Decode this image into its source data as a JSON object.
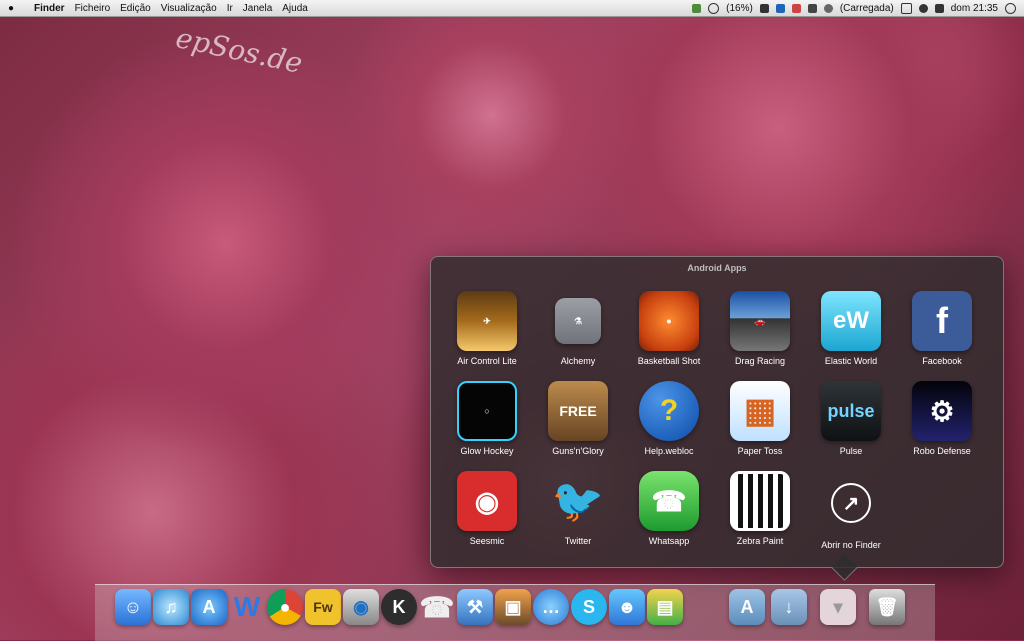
{
  "menubar": {
    "app_name": "Finder",
    "items": [
      "Ficheiro",
      "Edição",
      "Visualização",
      "Ir",
      "Janela",
      "Ajuda"
    ],
    "battery_percent": "(16%)",
    "battery_state": "(Carregada)",
    "clock": "dom 21:35"
  },
  "watermark": "epSos.de",
  "popover": {
    "title": "Android Apps",
    "apps": [
      {
        "label": "Air Control Lite",
        "icon": "airplane-icon"
      },
      {
        "label": "Alchemy",
        "icon": "flask-icon"
      },
      {
        "label": "Basketball Shot",
        "icon": "basketball-icon"
      },
      {
        "label": "Drag Racing",
        "icon": "race-car-icon"
      },
      {
        "label": "Elastic World",
        "icon": "elastic-world-icon"
      },
      {
        "label": "Facebook",
        "icon": "facebook-icon"
      },
      {
        "label": "Glow Hockey",
        "icon": "hockey-table-icon"
      },
      {
        "label": "Guns'n'Glory",
        "icon": "cowboy-icon"
      },
      {
        "label": "Help.webloc",
        "icon": "help-question-icon"
      },
      {
        "label": "Paper Toss",
        "icon": "trash-bin-icon"
      },
      {
        "label": "Pulse",
        "icon": "pulse-icon"
      },
      {
        "label": "Robo Defense",
        "icon": "robot-turret-icon"
      },
      {
        "label": "Seesmic",
        "icon": "raccoon-icon"
      },
      {
        "label": "Twitter",
        "icon": "bird-icon"
      },
      {
        "label": "Whatsapp",
        "icon": "phone-chat-icon"
      },
      {
        "label": "Zebra Paint",
        "icon": "zebra-icon"
      },
      {
        "label": "Abrir no Finder",
        "icon": "arrow-circle-icon"
      }
    ]
  },
  "dock": {
    "items": [
      {
        "name": "finder-icon"
      },
      {
        "name": "itunes-icon"
      },
      {
        "name": "app-store-icon"
      },
      {
        "name": "word-icon"
      },
      {
        "name": "chrome-icon"
      },
      {
        "name": "fireworks-icon"
      },
      {
        "name": "camera-icon"
      },
      {
        "name": "k-icon"
      },
      {
        "name": "phone-handset-icon"
      },
      {
        "name": "xcode-icon"
      },
      {
        "name": "photo-icon"
      },
      {
        "name": "chat-bubble-icon"
      },
      {
        "name": "skype-icon"
      },
      {
        "name": "messenger-icon"
      },
      {
        "name": "stack-icon"
      },
      {
        "name": "applications-folder-icon"
      },
      {
        "name": "downloads-folder-icon"
      },
      {
        "name": "android-apps-folder-icon"
      },
      {
        "name": "trash-icon"
      }
    ]
  },
  "colors": {
    "popover_bg": "#2d2d2d",
    "menubar_bg": "#e5e5e5"
  }
}
